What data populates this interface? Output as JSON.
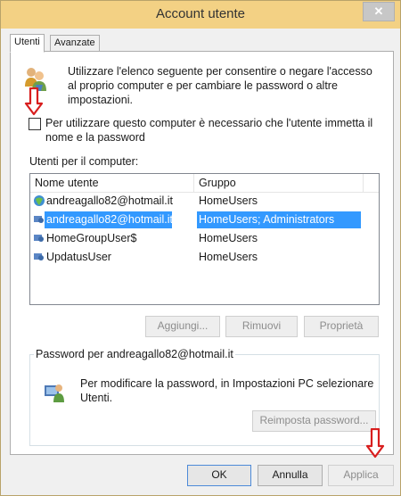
{
  "window": {
    "title": "Account utente",
    "close_glyph": "✕"
  },
  "tabs": [
    {
      "label": "Utenti",
      "active": true
    },
    {
      "label": "Avanzate",
      "active": false
    }
  ],
  "intro": {
    "text": "Utilizzare l'elenco seguente per consentire o negare l'accesso al proprio computer e per cambiare le password o altre impostazioni.",
    "icon": "users-icon"
  },
  "require_password": {
    "label": "Per utilizzare questo computer è necessario che l'utente immetta il nome e la password",
    "checked": false
  },
  "users_section": {
    "label": "Utenti per il computer:",
    "columns": [
      "Nome utente",
      "Gruppo"
    ],
    "rows": [
      {
        "name": "andreagallo82@hotmail.it",
        "group": "HomeUsers",
        "selected": false
      },
      {
        "name": "andreagallo82@hotmail.it",
        "group": "HomeUsers; Administrators",
        "selected": true
      },
      {
        "name": "HomeGroupUser$",
        "group": "HomeUsers",
        "selected": false
      },
      {
        "name": "UpdatusUser",
        "group": "HomeUsers",
        "selected": false
      }
    ]
  },
  "list_buttons": {
    "add": "Aggiungi...",
    "remove": "Rimuovi",
    "properties": "Proprietà"
  },
  "password_group": {
    "title": "Password per andreagallo82@hotmail.it",
    "text": "Per modificare la password, in Impostazioni PC selezionare Utenti.",
    "reset_button": "Reimposta password..."
  },
  "footer": {
    "ok": "OK",
    "cancel": "Annulla",
    "apply": "Applica"
  },
  "colors": {
    "titlebar": "#f3d184",
    "selection": "#3399ff",
    "annotation_arrow": "#d81e1e"
  }
}
